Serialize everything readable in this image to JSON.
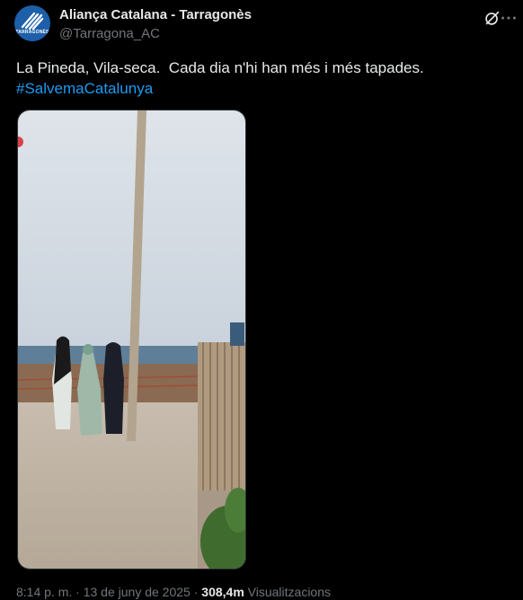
{
  "author": {
    "name": "Aliança Catalana - Tarragonès",
    "handle": "@Tarragona_AC",
    "avatar_label": "TARRAGONÈS"
  },
  "tweet": {
    "line1": "La Pineda, Vila-seca.  Cada dia n'hi han més i més tapades.",
    "hashtag": "#SalvemaCatalunya"
  },
  "meta": {
    "time": "8:14 p. m.",
    "separator": "·",
    "date": "13 de juny de 2025",
    "views_count": "308,4m",
    "views_label": "Visualitzacions"
  },
  "icons": {
    "grok": "grok-icon",
    "more": "more-icon"
  },
  "colors": {
    "background": "#000000",
    "text": "#e7e9ea",
    "secondary": "#71767b",
    "link": "#1d9bf0",
    "avatar": "#1d5fa8"
  }
}
